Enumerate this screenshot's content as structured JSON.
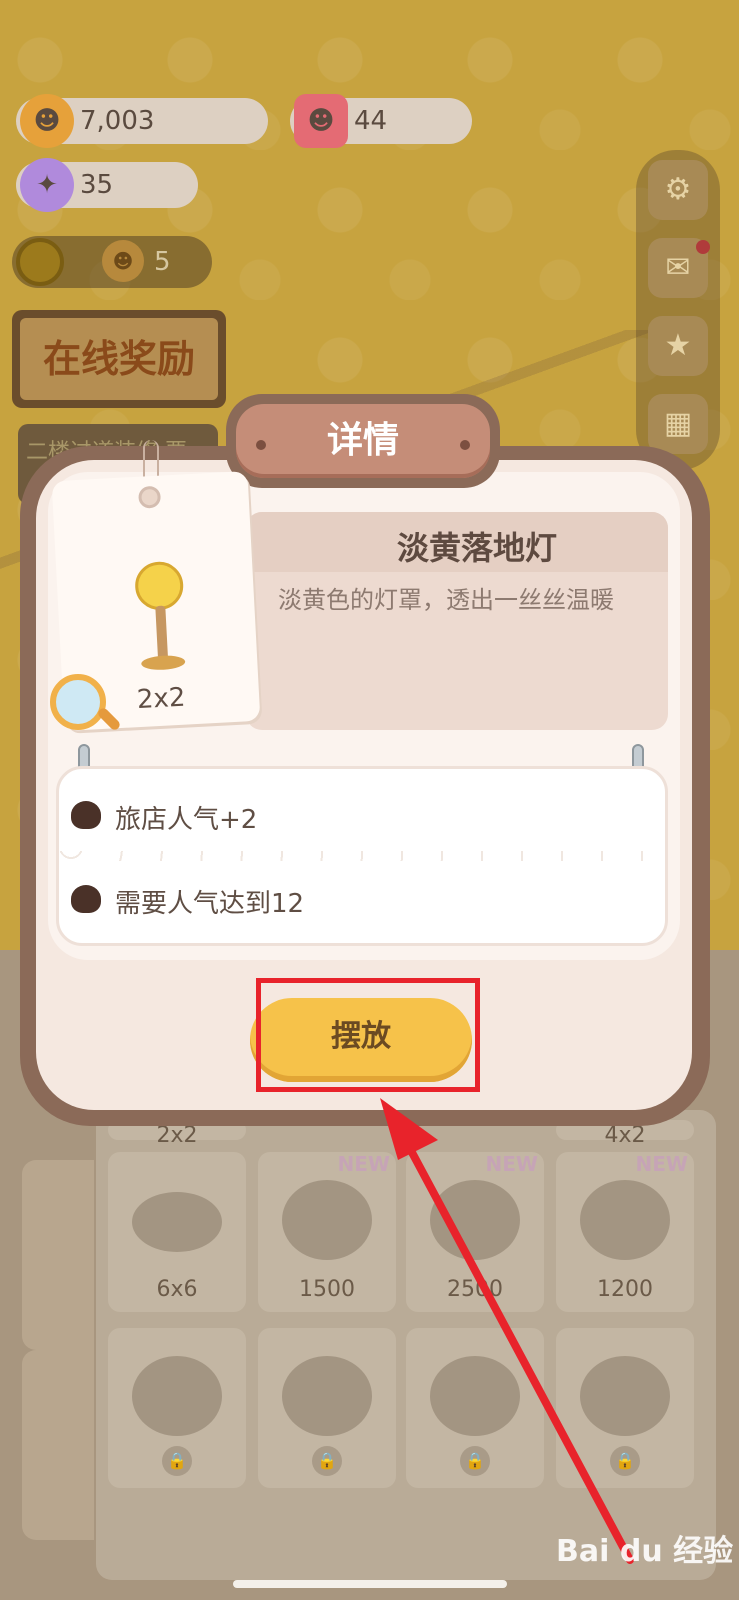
{
  "hud": {
    "coins": "7,003",
    "candles": "44",
    "candy": "35",
    "bread": "5"
  },
  "reward_sign": "在线奖励",
  "quest_text": "二楼过道装修 要…",
  "modal": {
    "title": "详情",
    "item_name": "淡黄落地灯",
    "item_desc": "淡黄色的灯罩，透出一丝丝温暖",
    "size": "2x2",
    "stats": [
      "旅店人气+2",
      "需要人气达到12"
    ],
    "place_button": "摆放"
  },
  "shop": {
    "cards": [
      {
        "label": "6x6",
        "new": false
      },
      {
        "label": "1500",
        "new": true
      },
      {
        "label": "2500",
        "new": true
      },
      {
        "label": "1200",
        "new": true
      }
    ],
    "new_badge": "NEW",
    "top_row_labels": [
      "2x2",
      "4x2"
    ]
  },
  "watermark": "Bai du 经验",
  "colors": {
    "highlight": "#e8232b",
    "button": "#f6c24a"
  }
}
